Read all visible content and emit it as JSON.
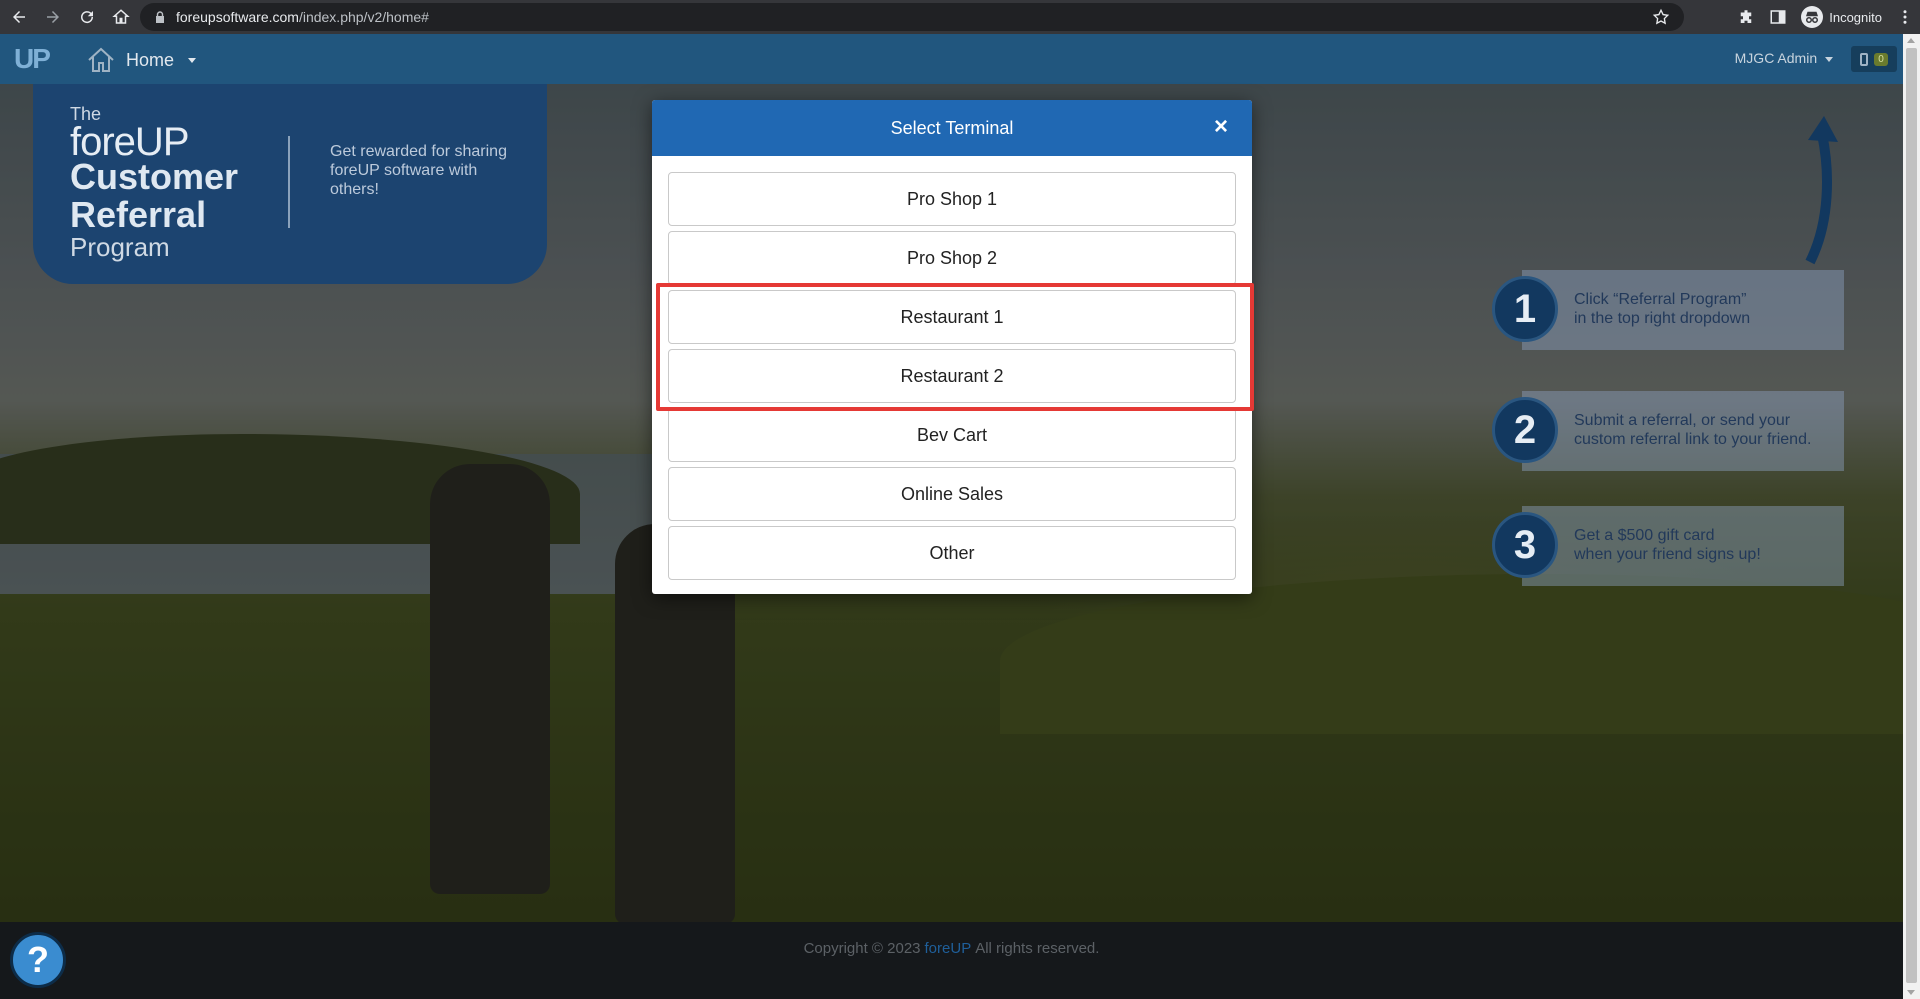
{
  "browser": {
    "url_host": "foreupsoftware.com",
    "url_path": "/index.php/v2/home#",
    "incognito_label": "Incognito"
  },
  "header": {
    "logo_text": "UP",
    "home_label": "Home",
    "admin_label": "MJGC Admin",
    "device_count": "0"
  },
  "referral": {
    "the": "The",
    "brand": "foreUP",
    "line1": "Customer",
    "line2": "Referral",
    "line3": "Program",
    "tagline": "Get rewarded for sharing foreUP software with others!"
  },
  "steps": [
    {
      "number": "1",
      "line1": "Click “Referral Program”",
      "line2": "in the top right dropdown"
    },
    {
      "number": "2",
      "line1": "Submit a referral, or send your",
      "line2": "custom referral link to your friend."
    },
    {
      "number": "3",
      "line1": "Get a $500 gift card",
      "line2": "when your friend signs up!"
    }
  ],
  "modal": {
    "title": "Select Terminal",
    "close_symbol": "×",
    "terminals": [
      "Pro Shop 1",
      "Pro Shop 2",
      "Restaurant 1",
      "Restaurant 2",
      "Bev Cart",
      "Online Sales",
      "Other"
    ]
  },
  "footer": {
    "prefix": "Copyright © 2023",
    "brand": "foreUP",
    "suffix": "All rights reserved."
  },
  "help": {
    "symbol": "?"
  },
  "colors": {
    "header_blue": "#21567e",
    "modal_header": "#2068b3",
    "highlight_red": "#e53935",
    "referral_navy": "#1c4470"
  }
}
